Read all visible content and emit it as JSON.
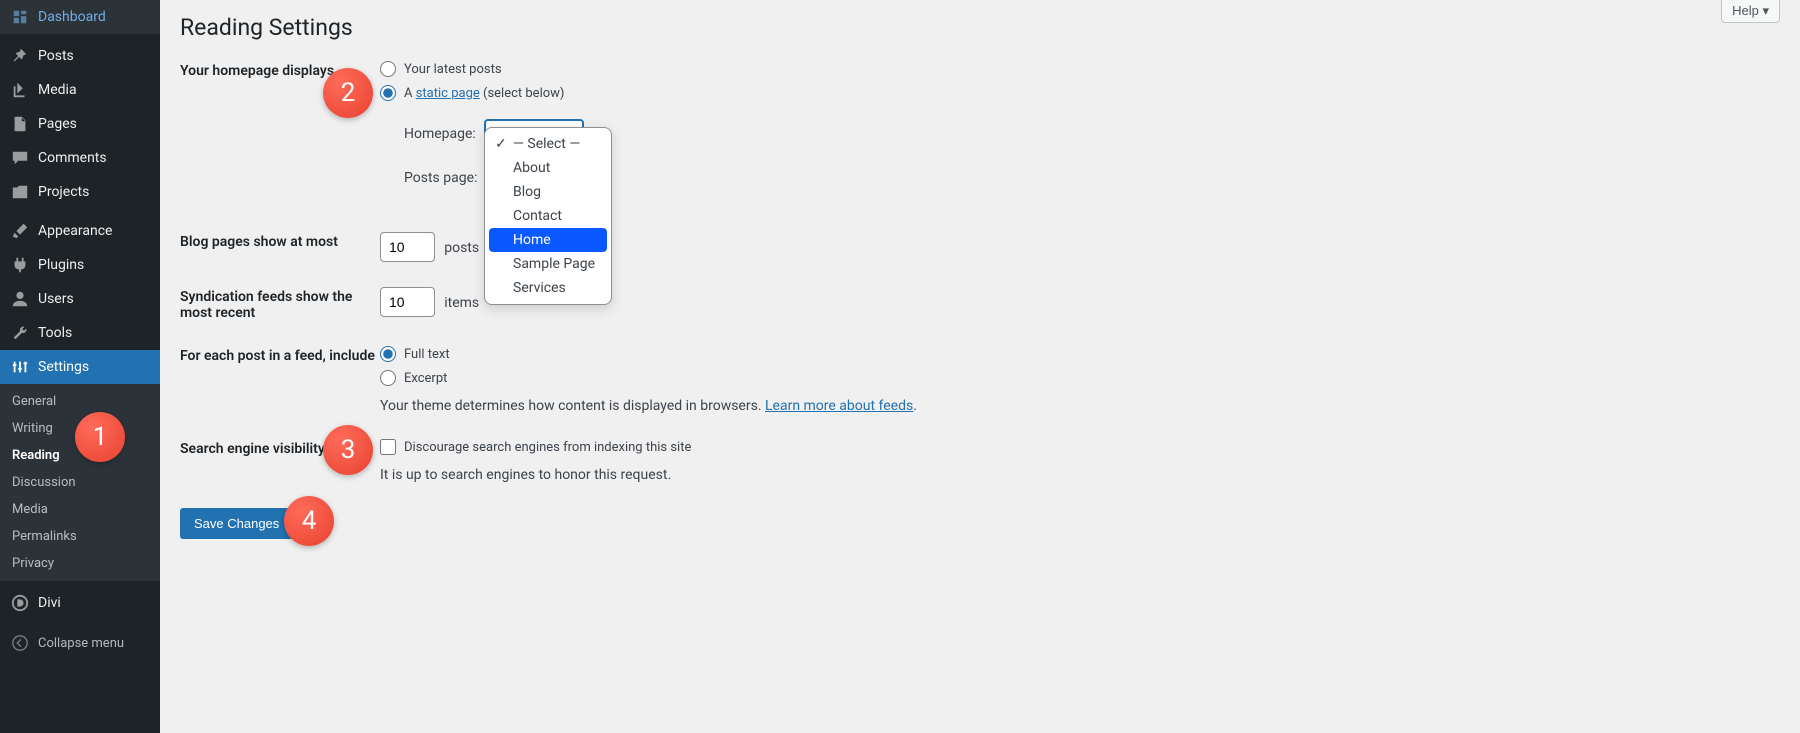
{
  "header": {
    "title": "Reading Settings",
    "help_label": "Help"
  },
  "sidebar": {
    "items": [
      {
        "label": "Dashboard",
        "icon": "dashboard"
      },
      {
        "label": "Posts",
        "icon": "pin"
      },
      {
        "label": "Media",
        "icon": "media"
      },
      {
        "label": "Pages",
        "icon": "page"
      },
      {
        "label": "Comments",
        "icon": "comment"
      },
      {
        "label": "Projects",
        "icon": "portfolio"
      }
    ],
    "items2": [
      {
        "label": "Appearance",
        "icon": "brush"
      },
      {
        "label": "Plugins",
        "icon": "plug"
      },
      {
        "label": "Users",
        "icon": "user"
      },
      {
        "label": "Tools",
        "icon": "wrench"
      },
      {
        "label": "Settings",
        "icon": "sliders"
      }
    ],
    "submenu": [
      {
        "label": "General"
      },
      {
        "label": "Writing"
      },
      {
        "label": "Reading"
      },
      {
        "label": "Discussion"
      },
      {
        "label": "Media"
      },
      {
        "label": "Permalinks"
      },
      {
        "label": "Privacy"
      }
    ],
    "items3": [
      {
        "label": "Divi",
        "icon": "divi"
      }
    ],
    "collapse_label": "Collapse menu"
  },
  "form": {
    "homepage_displays": {
      "label": "Your homepage displays",
      "opt1": "Your latest posts",
      "opt2_prefix": "A ",
      "opt2_link": "static page",
      "opt2_suffix": " (select below)",
      "homepage_label": "Homepage:",
      "posts_page_label": "Posts page:"
    },
    "dropdown": {
      "placeholder": "— Select —",
      "options": [
        "About",
        "Blog",
        "Contact",
        "Home",
        "Sample Page",
        "Services"
      ]
    },
    "blog_pages": {
      "label": "Blog pages show at most",
      "value": "10",
      "unit": "posts"
    },
    "syndication": {
      "label": "Syndication feeds show the most recent",
      "value": "10",
      "unit": "items"
    },
    "feed_include": {
      "label": "For each post in a feed, include",
      "opt1": "Full text",
      "opt2": "Excerpt",
      "desc_pre": "Your theme determines how content is displayed in browsers. ",
      "desc_link": "Learn more about feeds",
      "desc_post": "."
    },
    "search_visibility": {
      "label": "Search engine visibility",
      "check_label": "Discourage search engines from indexing this site",
      "desc": "It is up to search engines to honor this request."
    },
    "save_label": "Save Changes"
  },
  "badges": [
    "1",
    "2",
    "3",
    "4"
  ]
}
